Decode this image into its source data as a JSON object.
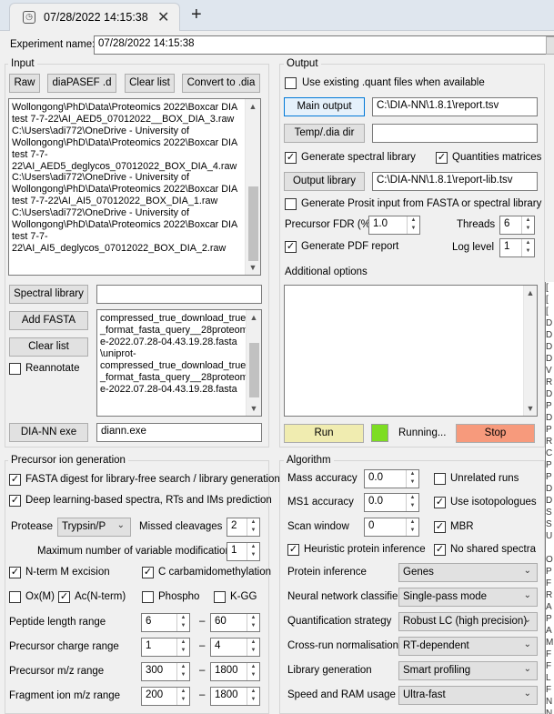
{
  "window": {
    "tab_title": "07/28/2022 14:15:38",
    "close": "✕",
    "new_tab": "+"
  },
  "experiment": {
    "label": "Experiment name:",
    "value": "07/28/2022 14:15:38"
  },
  "input": {
    "title": "Input",
    "raw": "Raw",
    "diapasef": "diaPASEF .d",
    "clear_list": "Clear list",
    "convert": "Convert to .dia",
    "files": "Wollongong\\PhD\\Data\\Proteomics 2022\\Boxcar DIA\ntest 7-7-22\\AI_AED5_07012022__BOX_DIA_3.raw\nC:\\Users\\adi772\\OneDrive - University of\nWollongong\\PhD\\Data\\Proteomics 2022\\Boxcar DIA\ntest 7-7-\n22\\AI_AED5_deglycos_07012022_BOX_DIA_4.raw\nC:\\Users\\adi772\\OneDrive - University of\nWollongong\\PhD\\Data\\Proteomics 2022\\Boxcar DIA\ntest 7-7-22\\AI_AI5_07012022_BOX_DIA_1.raw\nC:\\Users\\adi772\\OneDrive - University of\nWollongong\\PhD\\Data\\Proteomics 2022\\Boxcar DIA\ntest 7-7-\n22\\AI_AI5_deglycos_07012022_BOX_DIA_2.raw",
    "spectral_library": "Spectral library",
    "spectral_library_value": "",
    "add_fasta": "Add FASTA",
    "clear_list2": "Clear list",
    "reannotate": "Reannotate",
    "fasta_files": "compressed_true_download_true\n_format_fasta_query__28proteom\ne-2022.07.28-04.43.19.28.fasta\n\\uniprot-\ncompressed_true_download_true\n_format_fasta_query__28proteom\ne-2022.07.28-04.43.19.28.fasta",
    "diann_exe": "DIA-NN exe",
    "diann_exe_value": "diann.exe"
  },
  "output": {
    "title": "Output",
    "use_existing": "Use existing .quant files when available",
    "main_output": "Main output",
    "main_output_value": "C:\\DIA-NN\\1.8.1\\report.tsv",
    "temp_dir": "Temp/.dia dir",
    "temp_dir_value": "",
    "gen_spec_lib": "Generate spectral library",
    "quant_matrices": "Quantities matrices",
    "output_library": "Output library",
    "output_library_value": "C:\\DIA-NN\\1.8.1\\report-lib.tsv",
    "gen_prosit": "Generate Prosit input from FASTA or spectral library",
    "precursor_fdr": "Precursor FDR (%)",
    "precursor_fdr_value": "1.0",
    "threads": "Threads",
    "threads_value": "6",
    "gen_pdf": "Generate PDF report",
    "log_level": "Log level",
    "log_level_value": "1",
    "additional_options": "Additional options",
    "run": "Run",
    "running": "Running...",
    "stop": "Stop"
  },
  "precursor": {
    "title": "Precursor ion generation",
    "fasta_digest": "FASTA digest for library-free search / library generation",
    "deep_learning": "Deep learning-based spectra, RTs and IMs prediction",
    "protease": "Protease",
    "protease_value": "Trypsin/P",
    "missed_cleavages": "Missed cleavages",
    "missed_cleavages_value": "2",
    "max_var_mods": "Maximum number of variable modifications",
    "max_var_mods_value": "1",
    "nterm": "N-term M excision",
    "c_carb": "C carbamidomethylation",
    "ox": "Ox(M)",
    "ac": "Ac(N-term)",
    "phospho": "Phospho",
    "kgg": "K-GG",
    "dash": "–",
    "pep_len": "Peptide length range",
    "pep_len_min": "6",
    "pep_len_max": "60",
    "charge": "Precursor charge range",
    "charge_min": "1",
    "charge_max": "4",
    "prec_mz": "Precursor m/z range",
    "prec_mz_min": "300",
    "prec_mz_max": "1800",
    "frag_mz": "Fragment ion m/z range",
    "frag_mz_min": "200",
    "frag_mz_max": "1800"
  },
  "algorithm": {
    "title": "Algorithm",
    "mass_acc": "Mass accuracy",
    "mass_acc_value": "0.0",
    "ms1_acc": "MS1 accuracy",
    "ms1_acc_value": "0.0",
    "scan_window": "Scan window",
    "scan_window_value": "0",
    "unrelated_runs": "Unrelated runs",
    "use_isotopologues": "Use isotopologues",
    "mbr": "MBR",
    "heuristic": "Heuristic protein inference",
    "no_shared": "No shared spectra",
    "protein_inference": "Protein inference",
    "protein_inference_value": "Genes",
    "nn_classifier": "Neural network classifier",
    "nn_classifier_value": "Single-pass mode",
    "quant_strategy": "Quantification strategy",
    "quant_strategy_value": "Robust LC (high precision)",
    "cross_run": "Cross-run normalisation",
    "cross_run_value": "RT-dependent",
    "lib_gen": "Library generation",
    "lib_gen_value": "Smart profiling",
    "speed_ram": "Speed and RAM usage",
    "speed_ram_value": "Ultra-fast"
  },
  "log_strip": "[\n[\n[\nD\nD\nD\nD\nV\nR\nD\nP\nD\nP\nR\nC\nP\nP\nD\nD\nS\nS\nU\n\nO\nP\nF\nR\nA\nP\nA\nM\nF\nF\nL\nF\nN\nN\nM\nM\nN\nN\nN\nM\nN",
  "colors": {
    "run": "#f0ecb0",
    "running_indicator": "#7ddd22",
    "stop": "#f79a7c",
    "main_output_highlight": "#e5f1fb"
  }
}
